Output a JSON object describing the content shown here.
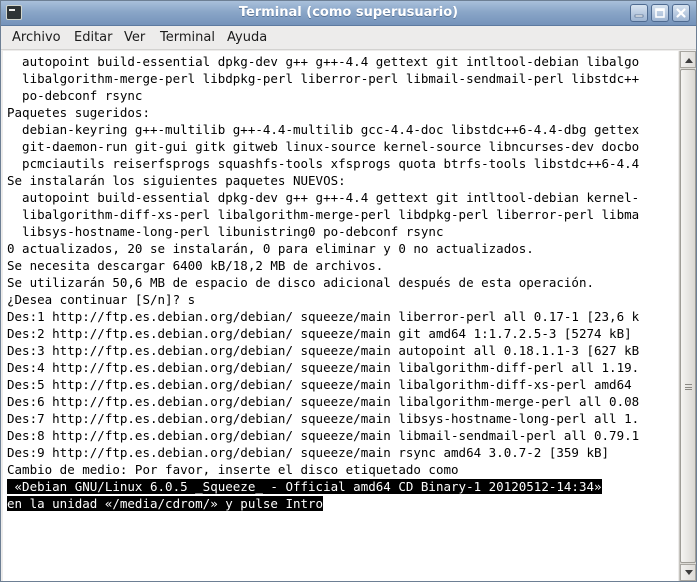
{
  "window": {
    "title": "Terminal (como superusuario)"
  },
  "menu": {
    "items": [
      "Archivo",
      "Editar",
      "Ver",
      "Terminal",
      "Ayuda"
    ]
  },
  "terminal": {
    "lines": [
      "  autopoint build-essential dpkg-dev g++ g++-4.4 gettext git intltool-debian libalgo",
      "  libalgorithm-merge-perl libdpkg-perl liberror-perl libmail-sendmail-perl libstdc++",
      "  po-debconf rsync",
      "Paquetes sugeridos:",
      "  debian-keyring g++-multilib g++-4.4-multilib gcc-4.4-doc libstdc++6-4.4-dbg gettex",
      "  git-daemon-run git-gui gitk gitweb linux-source kernel-source libncurses-dev docbo",
      "  pcmciautils reiserfsprogs squashfs-tools xfsprogs quota btrfs-tools libstdc++6-4.4",
      "Se instalarán los siguientes paquetes NUEVOS:",
      "  autopoint build-essential dpkg-dev g++ g++-4.4 gettext git intltool-debian kernel-",
      "  libalgorithm-diff-xs-perl libalgorithm-merge-perl libdpkg-perl liberror-perl libma",
      "  libsys-hostname-long-perl libunistring0 po-debconf rsync",
      "0 actualizados, 20 se instalarán, 0 para eliminar y 0 no actualizados.",
      "Se necesita descargar 6400 kB/18,2 MB de archivos.",
      "Se utilizarán 50,6 MB de espacio de disco adicional después de esta operación.",
      "¿Desea continuar [S/n]? s",
      "Des:1 http://ftp.es.debian.org/debian/ squeeze/main liberror-perl all 0.17-1 [23,6 k",
      "Des:2 http://ftp.es.debian.org/debian/ squeeze/main git amd64 1:1.7.2.5-3 [5274 kB]",
      "Des:3 http://ftp.es.debian.org/debian/ squeeze/main autopoint all 0.18.1.1-3 [627 kB",
      "Des:4 http://ftp.es.debian.org/debian/ squeeze/main libalgorithm-diff-perl all 1.19.",
      "Des:5 http://ftp.es.debian.org/debian/ squeeze/main libalgorithm-diff-xs-perl amd64 ",
      "Des:6 http://ftp.es.debian.org/debian/ squeeze/main libalgorithm-merge-perl all 0.08",
      "Des:7 http://ftp.es.debian.org/debian/ squeeze/main libsys-hostname-long-perl all 1.",
      "Des:8 http://ftp.es.debian.org/debian/ squeeze/main libmail-sendmail-perl all 0.79.1",
      "Des:9 http://ftp.es.debian.org/debian/ squeeze/main rsync amd64 3.0.7-2 [359 kB]",
      "Cambio de medio: Por favor, inserte el disco etiquetado como"
    ],
    "highlighted_lines": [
      " «Debian GNU/Linux 6.0.5 _Squeeze_ - Official amd64 CD Binary-1 20120512-14:34»",
      "en la unidad «/media/cdrom/» y pulse Intro"
    ]
  },
  "colors": {
    "titlebar": "#8aa6c8",
    "terminal_bg": "#ffffff",
    "terminal_fg": "#000000",
    "highlight_bg": "#000000",
    "highlight_fg": "#ffffff"
  },
  "icons": {
    "app": "terminal-icon",
    "minimize": "minimize-icon",
    "maximize": "maximize-icon",
    "close": "close-icon",
    "scroll_up": "arrow-up-icon",
    "scroll_down": "arrow-down-icon"
  }
}
